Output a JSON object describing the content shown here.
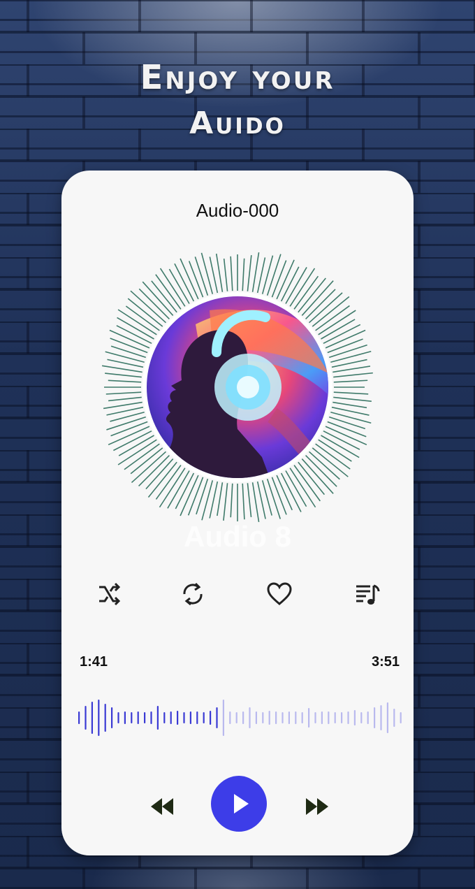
{
  "headline": {
    "line1": "Enjoy your",
    "line2": "Auido"
  },
  "player": {
    "track_title": "Audio-000",
    "faded_track_name": "Audio 8",
    "elapsed": "1:41",
    "duration": "3:51",
    "progress": 0.44
  },
  "controls": {
    "icons": [
      "shuffle-icon",
      "repeat-icon",
      "heart-icon",
      "queue-music-icon"
    ],
    "transport": [
      "rewind-icon",
      "play-icon",
      "fast-forward-icon"
    ]
  },
  "colors": {
    "accent": "#3d3de8",
    "wave_played": "#3a3ad4",
    "wave_unplayed": "#b9b9ee",
    "ring": "#3f7a6a",
    "card": "#f7f7f7"
  }
}
